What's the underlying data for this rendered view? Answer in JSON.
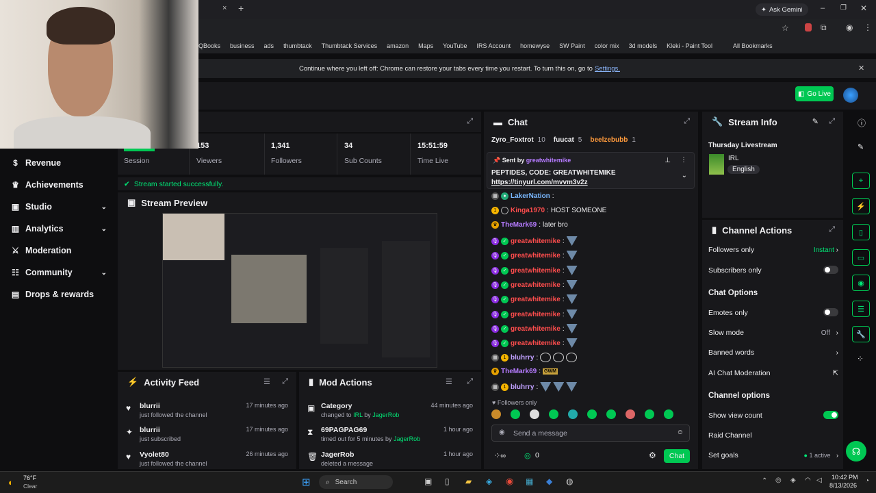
{
  "browser": {
    "tab_close": "×",
    "tab_new": "+",
    "gemini": "Ask Gemini",
    "bookmarks": [
      "QBooks",
      "business",
      "ads",
      "thumbtack",
      "Thumbtack Services",
      "amazon",
      "Maps",
      "YouTube",
      "IRS Account",
      "homewyse",
      "SW Paint",
      "color mix",
      "3d models",
      "Kleki - Paint Tool"
    ],
    "all_bookmarks": "All Bookmarks",
    "restore_msg": "Continue where you left off: Chrome can restore your tabs every time you restart. To turn this on, go to",
    "restore_link": "Settings."
  },
  "header": {
    "golive": "Go Live"
  },
  "sidebar": {
    "items": [
      {
        "label": "Revenue",
        "icon": "dollar-icon"
      },
      {
        "label": "Achievements",
        "icon": "trophy-icon"
      },
      {
        "label": "Studio",
        "icon": "film-icon",
        "chevron": true
      },
      {
        "label": "Analytics",
        "icon": "chart-icon",
        "chevron": true
      },
      {
        "label": "Moderation",
        "icon": "sword-icon"
      },
      {
        "label": "Community",
        "icon": "people-icon",
        "chevron": true
      },
      {
        "label": "Drops & rewards",
        "icon": "gift-icon"
      }
    ]
  },
  "stats": {
    "session_label": "Session",
    "viewers_value": "153",
    "viewers_label": "Viewers",
    "followers_value": "1,341",
    "followers_label": "Followers",
    "subs_value": "34",
    "subs_label": "Sub Counts",
    "time_value": "15:51:59",
    "time_label": "Time Live"
  },
  "success": "Stream started successfully.",
  "preview": {
    "title": "Stream Preview"
  },
  "activity": {
    "title": "Activity Feed",
    "rows": [
      {
        "name": "blurrii",
        "action": "just followed the channel",
        "time": "17 minutes ago"
      },
      {
        "name": "blurrii",
        "action": "just subscribed",
        "time": "17 minutes ago"
      },
      {
        "name": "Vyolet80",
        "action": "just followed the channel",
        "time": "26 minutes ago"
      }
    ]
  },
  "modactions": {
    "title": "Mod Actions",
    "rows": [
      {
        "title": "Category",
        "pre": "changed to",
        "v1": "IRL",
        "mid": "by",
        "v2": "JagerRob",
        "time": "44 minutes ago"
      },
      {
        "title": "69PAGPAG69",
        "pre": "timed out for 5 minutes by",
        "v1": "",
        "mid": "",
        "v2": "JagerRob",
        "time": "1 hour ago"
      },
      {
        "title": "JagerRob",
        "pre": "deleted a message",
        "v1": "",
        "mid": "",
        "v2": "",
        "time": "1 hour ago"
      }
    ]
  },
  "chat": {
    "title": "Chat",
    "top_row": {
      "u1": "Zyro_Foxtrot",
      "n1": "10",
      "u2": "fuucat",
      "n2": "5",
      "u3": "beelzebubb",
      "n3": "1"
    },
    "pinned": {
      "sent_by": "Sent by",
      "sender": "greatwhitemike",
      "text": "PEPTIDES, CODE: GREATWHITEMIKE",
      "link": "https://tinyurl.com/mvvm3v2z"
    },
    "messages": [
      {
        "user": "LakerNation",
        "color": "blue",
        "text": ""
      },
      {
        "user": "Kinga1970",
        "color": "red",
        "text": "HOST SOMEONE"
      },
      {
        "user": "TheMark69",
        "color": "purple",
        "text": "later bro"
      },
      {
        "user": "greatwhitemike",
        "color": "red",
        "text": ""
      },
      {
        "user": "greatwhitemike",
        "color": "red",
        "text": ""
      },
      {
        "user": "greatwhitemike",
        "color": "red",
        "text": ""
      },
      {
        "user": "greatwhitemike",
        "color": "red",
        "text": ""
      },
      {
        "user": "greatwhitemike",
        "color": "red",
        "text": ""
      },
      {
        "user": "greatwhitemike",
        "color": "red",
        "text": ""
      },
      {
        "user": "greatwhitemike",
        "color": "red",
        "text": ""
      },
      {
        "user": "greatwhitemike",
        "color": "red",
        "text": ""
      },
      {
        "user": "bluhrry",
        "color": "lav",
        "text": ""
      },
      {
        "user": "TheMark69",
        "color": "purple",
        "text": "GWM"
      },
      {
        "user": "bluhrry",
        "color": "lav",
        "text": ""
      }
    ],
    "followers_only": "Followers only",
    "placeholder": "Send a message",
    "points": "0",
    "chat_button": "Chat"
  },
  "streaminfo": {
    "title": "Stream Info",
    "stream_title": "Thursday Livestream",
    "category": "IRL",
    "language": "English"
  },
  "channel_actions": {
    "title": "Channel Actions",
    "followers_only": "Followers only",
    "followers_only_value": "Instant",
    "subscribers_only": "Subscribers only",
    "chat_options": "Chat Options",
    "emotes_only": "Emotes only",
    "slow_mode": "Slow mode",
    "slow_mode_value": "Off",
    "banned_words": "Banned words",
    "ai_mod": "AI Chat Moderation",
    "channel_options": "Channel options",
    "show_view_count": "Show view count",
    "raid": "Raid Channel",
    "set_goals": "Set goals",
    "goals_value": "1 active"
  },
  "taskbar": {
    "weather_temp": "76°F",
    "weather_desc": "Clear",
    "search": "Search",
    "time": "10:42 PM",
    "date": "8/13/2026"
  },
  "colors": {
    "accent": "#00c853",
    "bg": "#0e0e10",
    "panel": "#18181b"
  }
}
